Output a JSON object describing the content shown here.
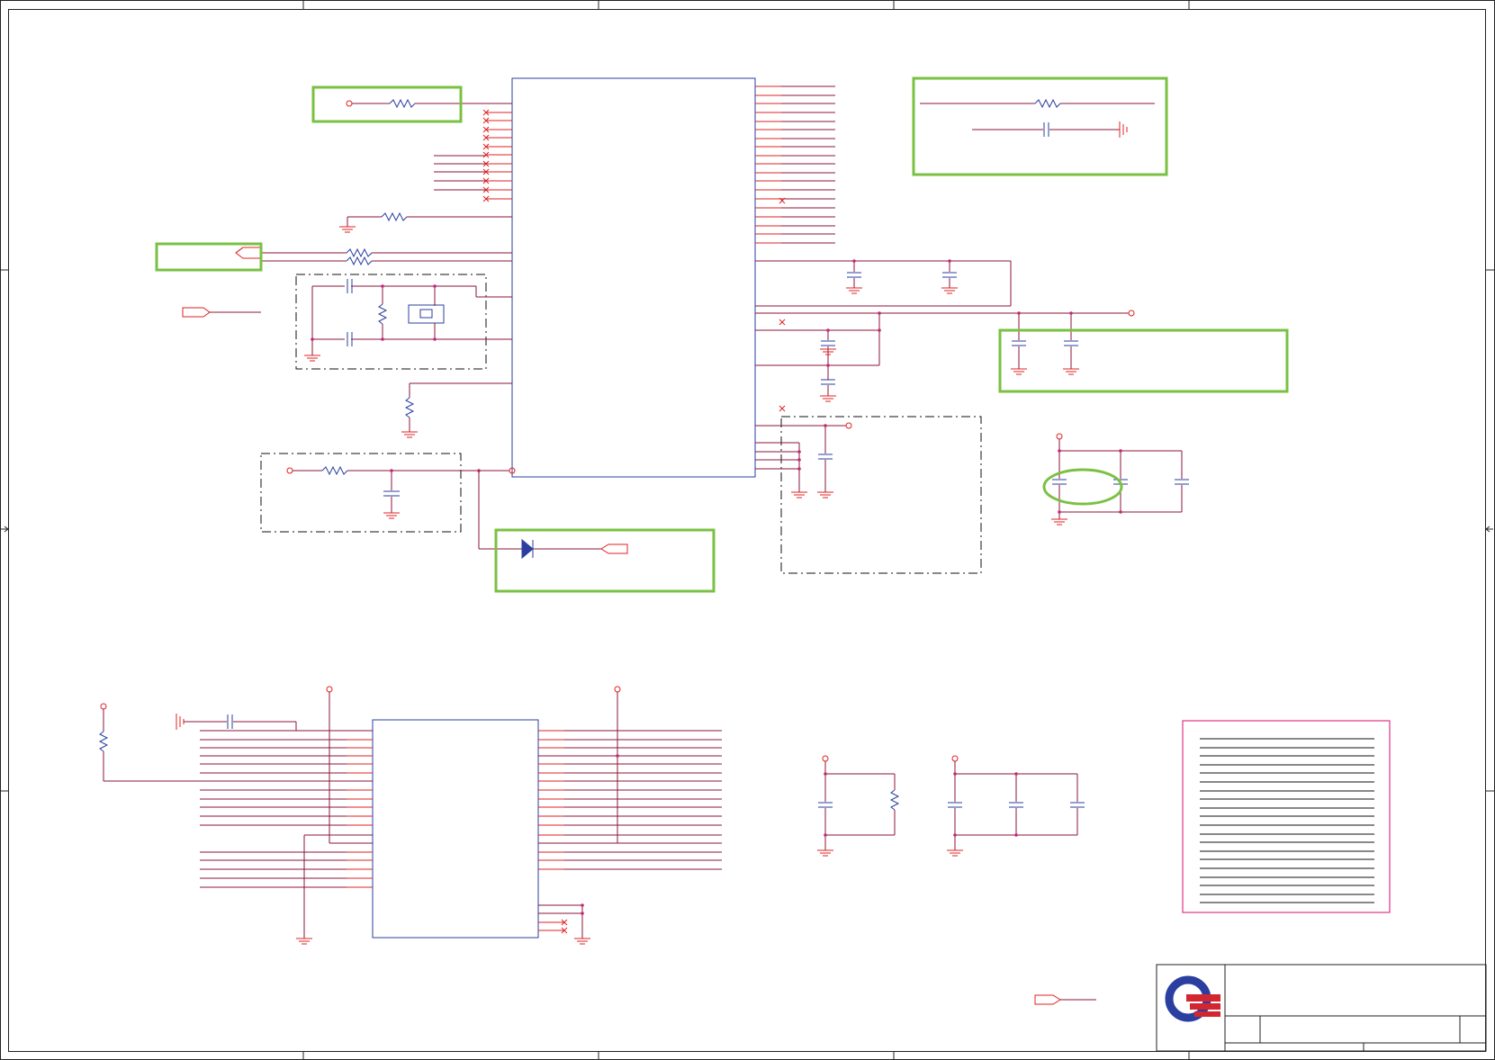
{
  "document": {
    "type": "schematic-sheet",
    "colors": {
      "wire": "#8b1538",
      "pin": "#e02020",
      "component": "#2a3f9f",
      "highlight": "#7ac143",
      "note_box": "#e0338a",
      "border": "#222222"
    }
  },
  "components": {
    "main_ic": {
      "kind": "ic-block"
    },
    "secondary_ic": {
      "kind": "ic-block"
    },
    "crystal": {
      "kind": "crystal"
    },
    "diode": {
      "kind": "diode"
    }
  },
  "icons": {
    "logo": "company-logo",
    "ground": "ground-icon",
    "connector": "offpage-connector-icon"
  },
  "annotations": {
    "highlight_boxes": 6,
    "highlight_ellipses": 1,
    "dashed_groups": 4
  }
}
